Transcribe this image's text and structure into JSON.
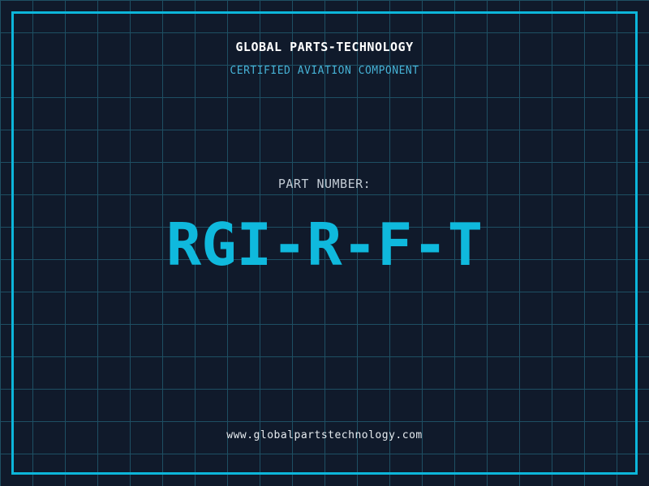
{
  "label": {
    "company": "GLOBAL PARTS-TECHNOLOGY",
    "certification": "CERTIFIED AVIATION COMPONENT",
    "part_label": "PART NUMBER:",
    "part_number": "RGI-R-F-T",
    "website": "www.globalpartstechnology.com"
  },
  "colors": {
    "background": "#101a2b",
    "grid-line": "#1e4f63",
    "frame": "#0cb6da",
    "part-number": "#0fb9dd",
    "subtitle": "#46b2d6",
    "muted-label": "#c3ccd5",
    "heading": "#ffffff",
    "footer": "#e6ebef"
  }
}
